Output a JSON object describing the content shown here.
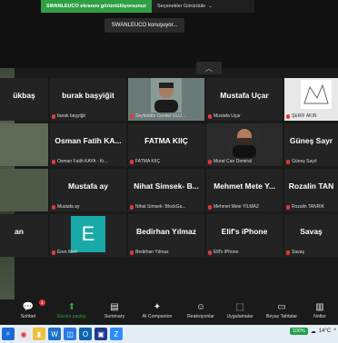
{
  "share_bar": {
    "status": "SWANLEUCO ekranını görüntülüyorsunuz",
    "options": "Seçenekler Görüntüle"
  },
  "speaking": "SWANLEUCO konuşuyor...",
  "tiles": [
    {
      "name": "ükbaş",
      "label": ""
    },
    {
      "name": "burak başyiğit",
      "label": "burak başyiğit"
    },
    {
      "name": "",
      "label": "Seyfeddin Cevdet ULU..."
    },
    {
      "name": "Mustafa Uçar",
      "label": "Mustafa Uçar"
    },
    {
      "name": "",
      "label": "ŞERİF AKIN"
    },
    {
      "name": "",
      "label": ""
    },
    {
      "name": "Osman Fatih KA...",
      "label": "Osman Fatih KAYA - Kr..."
    },
    {
      "name": "FATMA KIIÇ",
      "label": "FATMA KIIÇ"
    },
    {
      "name": "",
      "label": "Murat Can Demiral"
    },
    {
      "name": "Güneş Sayr",
      "label": "Güneş Sayrl"
    },
    {
      "name": "",
      "label": ""
    },
    {
      "name": "Mustafa ay",
      "label": "Mustafa ay"
    },
    {
      "name": "Nihat Simsek- B...",
      "label": "Nihat Simsek- BlockGa..."
    },
    {
      "name": "Mehmet Mete Y...",
      "label": "Mehmet Mete YILMAZ"
    },
    {
      "name": "Rozalin TAN",
      "label": "Rozalin TANRIK"
    },
    {
      "name": "an",
      "label": ""
    },
    {
      "name": "",
      "label": "Eren Mert"
    },
    {
      "name": "Bedirhan Yılmaz",
      "label": "Bedirhan Yılmaz"
    },
    {
      "name": "Elif's iPhone",
      "label": "Elif's iPhone"
    },
    {
      "name": "Savaş",
      "label": "Savaş"
    }
  ],
  "avatar_letter": "E",
  "toolbar": [
    {
      "label": "Sohbet",
      "icon": "chat-icon",
      "badge": "1"
    },
    {
      "label": "Ekranı paylaş",
      "icon": "share-screen-icon"
    },
    {
      "label": "Summary",
      "icon": "summary-icon"
    },
    {
      "label": "AI Companion",
      "icon": "sparkle-icon"
    },
    {
      "label": "Reaksiyonlar",
      "icon": "reaction-icon"
    },
    {
      "label": "Uygulamalar",
      "icon": "apps-icon"
    },
    {
      "label": "Beyaz Tahtalar",
      "icon": "whiteboard-icon"
    },
    {
      "label": "Notlar",
      "icon": "notes-icon"
    }
  ],
  "taskbar": {
    "battery": "100%",
    "temp": "14°C"
  },
  "colors": {
    "accent_green": "#2ea043",
    "mic_red": "#e23a3a",
    "avatar_teal": "#1aa9a9"
  }
}
